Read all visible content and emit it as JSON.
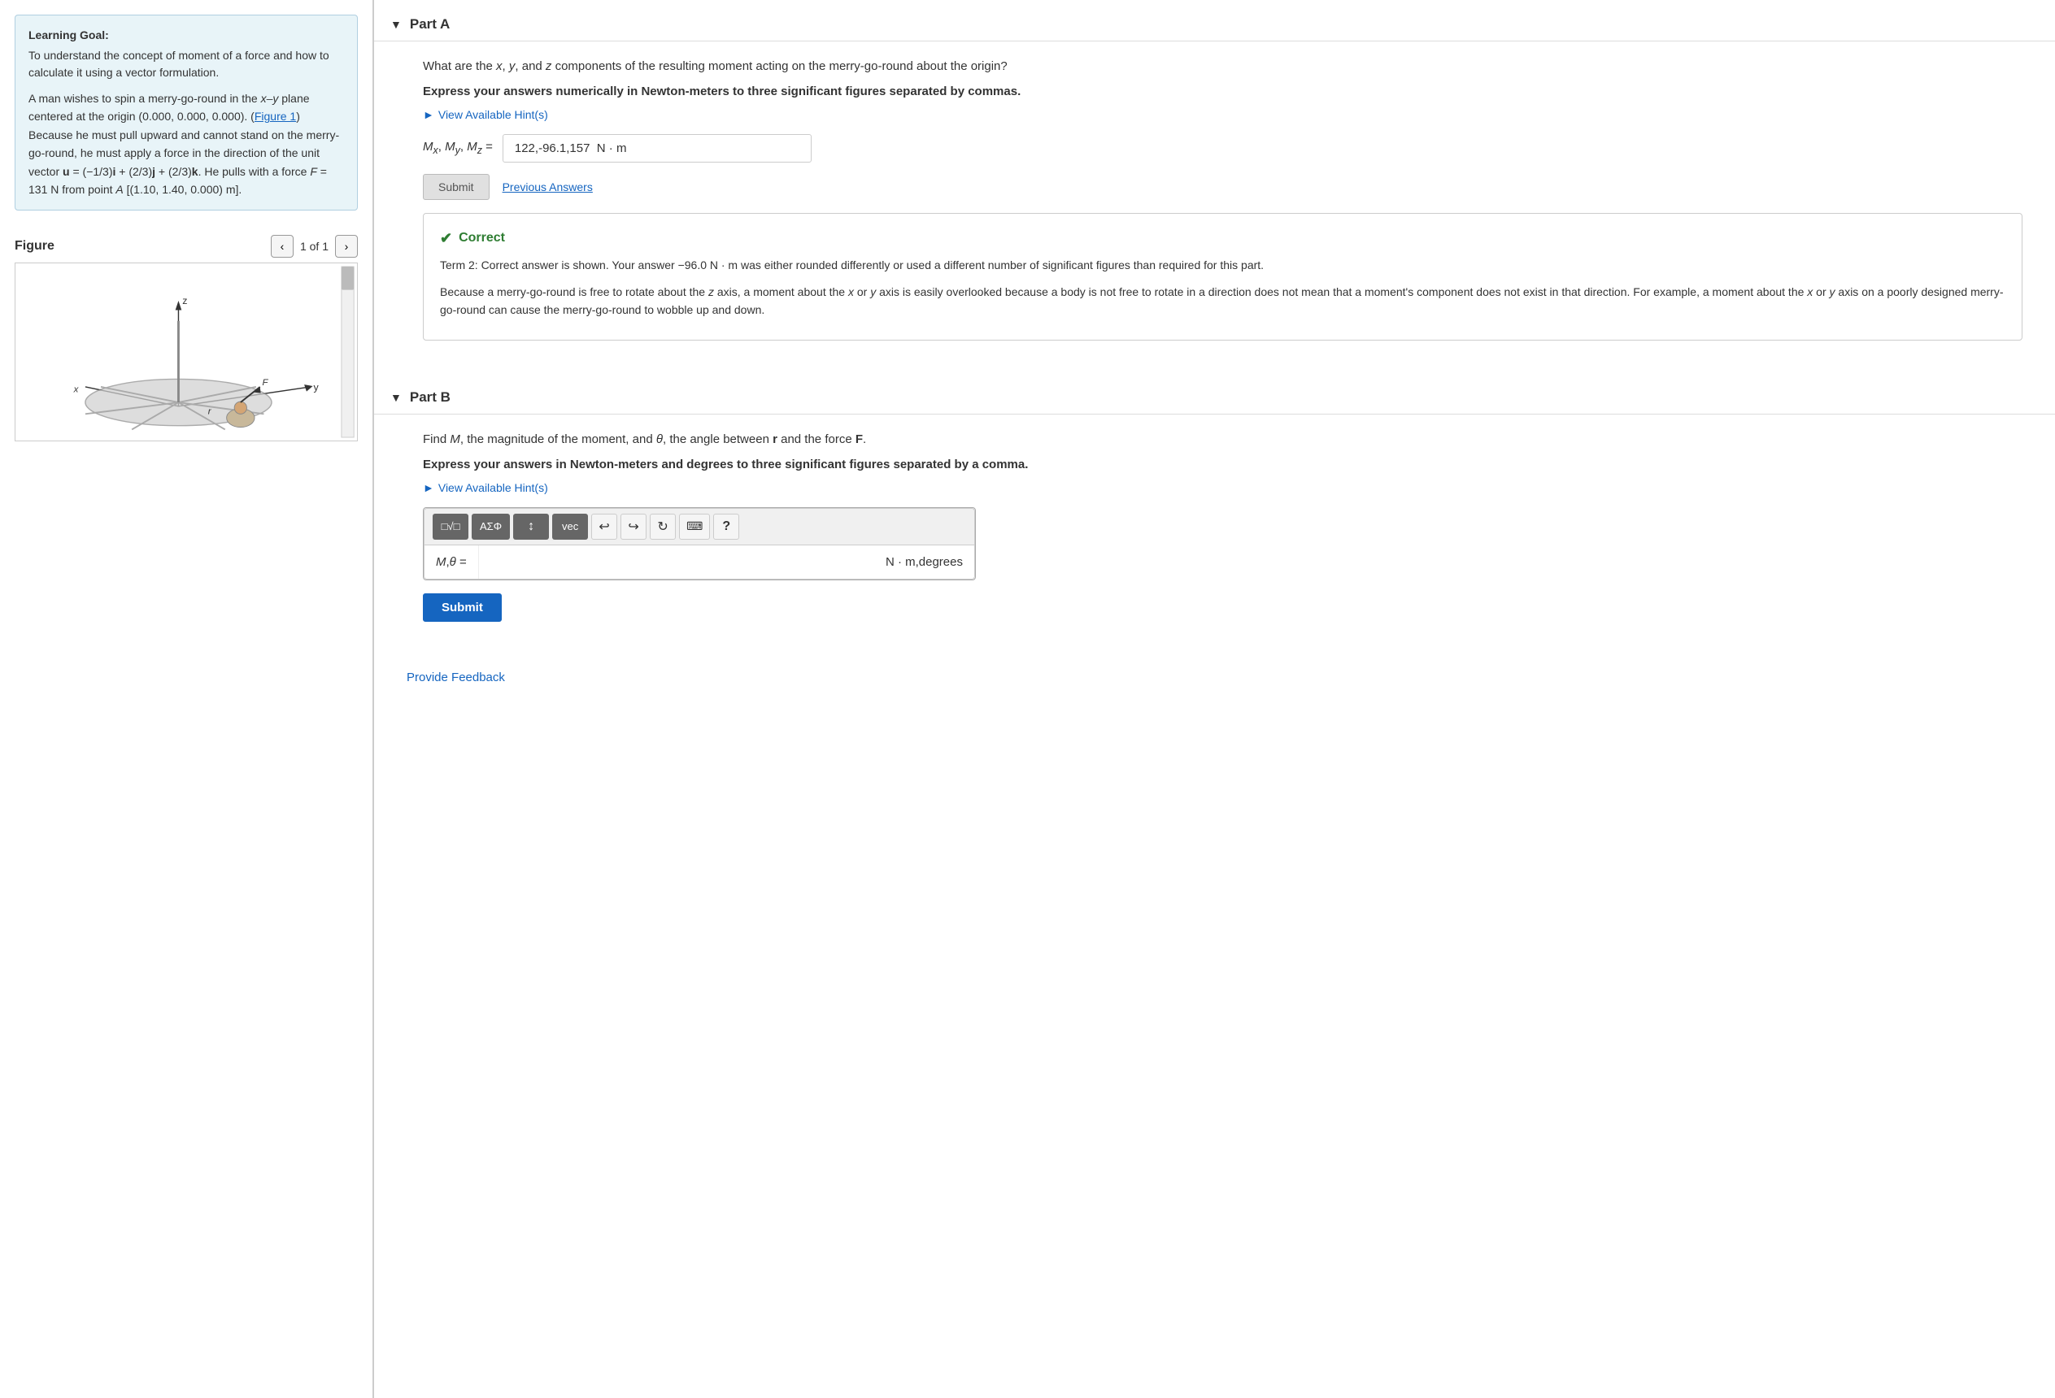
{
  "left": {
    "learning_goal_title": "Learning Goal:",
    "learning_goal_text1": "To understand the concept of moment of a force and how to calculate it using a vector formulation.",
    "learning_goal_text2": "A man wishes to spin a merry-go-round in the x–y plane centered at the origin (0.000, 0.000, 0.000). (Figure 1) Because he must pull upward and cannot stand on the merry-go-round, he must apply a force in the direction of the unit vector",
    "learning_goal_math": "u = (−1/3)i + (2/3)j + (2/3)k",
    "learning_goal_text3": ". He pulls with a force F = 131 N from point A [(1.10, 1.40, 0.000) m].",
    "figure_title": "Figure",
    "figure_nav": "1 of 1"
  },
  "right": {
    "part_a": {
      "label": "Part A",
      "question": "What are the x, y, and z components of the resulting moment acting on the merry-go-round about the origin?",
      "express": "Express your answers numerically in Newton-meters to three significant figures separated by commas.",
      "hint_label": "View Available Hint(s)",
      "answer_label": "Mx, My, Mz =",
      "answer_value": "122,-96.1,157  N · m",
      "answer_unit": "",
      "submit_label": "Submit",
      "prev_answers_label": "Previous Answers",
      "feedback_title": "Correct",
      "feedback_term": "Term 2: Correct answer is shown. Your answer −96.0 N · m was either rounded differently or used a different number of significant figures than required for this part.",
      "feedback_extra": "Because a merry-go-round is free to rotate about the z axis, a moment about the x or y axis is easily overlooked because a body is not free to rotate in a direction does not mean that a moment's component does not exist in that direction. For example, a moment about the x or y axis on a poorly designed merry-go-round can cause the merry-go-round to wobble up and down."
    },
    "part_b": {
      "label": "Part B",
      "question_text": "Find M, the magnitude of the moment, and θ, the angle between r and the force F.",
      "express": "Express your answers in Newton-meters and degrees to three significant figures separated by a comma.",
      "hint_label": "View Available Hint(s)",
      "toolbar": {
        "btn1": "√□",
        "btn2": "AΣΦ",
        "btn3": "↕",
        "btn4": "vec",
        "undo": "↩",
        "redo": "↪",
        "refresh": "↻",
        "keyboard": "⌨",
        "help": "?"
      },
      "answer_label": "M,θ =",
      "answer_unit": "N · m,degrees",
      "submit_label": "Submit"
    },
    "provide_feedback": "Provide Feedback"
  }
}
